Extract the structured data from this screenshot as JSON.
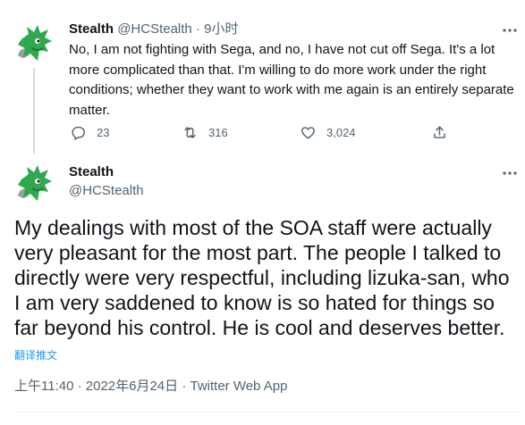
{
  "reply_tweet": {
    "display_name": "Stealth",
    "handle": "@HCStealth",
    "separator": "·",
    "time_ago": "9小时",
    "text": "No, I am not fighting with Sega, and no, I have not cut off Sega. It's a lot more complicated than that. I'm willing to do more work under the right conditions; whether they want to work with me again is an entirely separate matter.",
    "replies": "23",
    "retweets": "316",
    "likes": "3,024"
  },
  "main_tweet": {
    "display_name": "Stealth",
    "handle": "@HCStealth",
    "text": "My dealings with most of the SOA staff were actually very pleasant for the most part. The people I talked to directly were very respectful, including lizuka-san, who I am very saddened to know is so hated for things so far beyond his control. He is cool and deserves better.",
    "translate_label": "翻译推文",
    "timestamp": "上午11:40 · 2022年6月24日 · Twitter Web App"
  },
  "colors": {
    "text_primary": "#0f1419",
    "text_secondary": "#536471",
    "link_blue": "#1d9bf0",
    "avatar_green": "#2fa84f",
    "avatar_gray": "#8a8f96"
  },
  "icons": {
    "reply": "reply-icon",
    "retweet": "retweet-icon",
    "like": "heart-icon",
    "share": "share-icon",
    "more": "more-options-icon"
  }
}
